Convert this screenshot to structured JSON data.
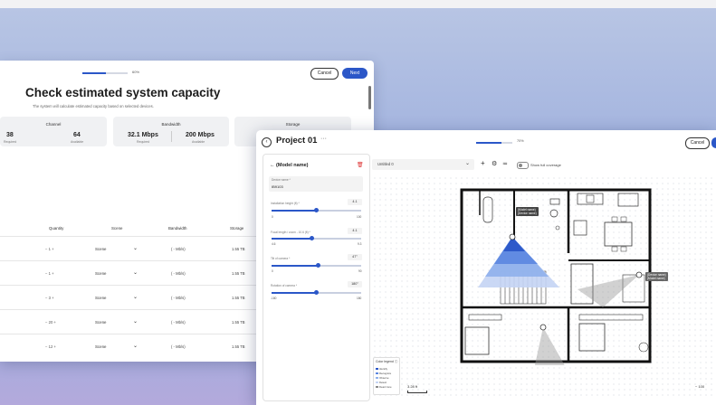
{
  "back_window": {
    "progress_pct": "60%",
    "progress_fraction": 0.52,
    "cancel_label": "Cancel",
    "next_label": "Next",
    "title": "Check estimated system capacity",
    "subtitle": "The system will calculate estimated capacity based on selected devices.",
    "cards": {
      "channel": {
        "title": "Channel",
        "required_value": "38",
        "required_label": "Required",
        "available_value": "64",
        "available_label": "Available"
      },
      "bandwidth": {
        "title": "Bandwidth",
        "required_value": "32.1 Mbps",
        "required_label": "Required",
        "available_value": "200 Mbps",
        "available_label": "Available"
      },
      "storage": {
        "title": "Storage"
      }
    },
    "table": {
      "headers": {
        "quantity": "Quantity",
        "scene": "Scene",
        "bandwidth": "Bandwidth",
        "storage": "Storage"
      },
      "rows": [
        {
          "qty": "− 1 +",
          "scene": "Scene",
          "bandwidth": "( - Mb/s)",
          "storage": "1.55 TB"
        },
        {
          "qty": "− 1 +",
          "scene": "Scene",
          "bandwidth": "( - Mb/s)",
          "storage": "1.55 TB"
        },
        {
          "qty": "− 3 +",
          "scene": "Scene",
          "bandwidth": "( - Mb/s)",
          "storage": "1.55 TB"
        },
        {
          "qty": "− 20 +",
          "scene": "Scene",
          "bandwidth": "( - Mb/s)",
          "storage": "1.55 TB"
        },
        {
          "qty": "− 12 +",
          "scene": "Scene",
          "bandwidth": "( - Mb/s)",
          "storage": "1.55 TB"
        }
      ]
    }
  },
  "front_window": {
    "title": "Project 01",
    "menu_glyph": "···",
    "progress_pct": "70%",
    "progress_fraction": 0.7,
    "cancel_label": "Cancel",
    "panel": {
      "title": "(Model name)",
      "device_name_label": "Device name *",
      "device_name_value": "IB9103",
      "sliders": [
        {
          "label": "Installation height (ft) *",
          "value": "4.1",
          "min": "0",
          "max": "100",
          "fraction": 0.5
        },
        {
          "label": "Focal length / zoom - 10.6 (ft) *",
          "value": "4.1",
          "min": "4.6",
          "max": "9.3",
          "fraction": 0.45
        },
        {
          "label": "Tilt of camera *",
          "value": "47°",
          "min": "0",
          "max": "90",
          "fraction": 0.52
        },
        {
          "label": "Rotation of camera *",
          "value": "180°",
          "min": "-180",
          "max": "180",
          "fraction": 0.5
        }
      ]
    },
    "toolbar": {
      "layout_select": "Untitled 0",
      "show_full_coverage": "Show full coverage",
      "toggle_on": false
    },
    "canvas": {
      "camera_tag_1": "(Model name)",
      "camera_tag_1b": "(Device name)",
      "camera_tag_2": "(Device name)",
      "camera_tag_2b": "(Model name)",
      "scale_label": "3.28 ft",
      "zoom_label": "− 100"
    },
    "legend": {
      "title": "Color legend",
      "items": [
        {
          "label": "Identify",
          "color": "#2b57c8"
        },
        {
          "label": "Recognize",
          "color": "#5b86e0"
        },
        {
          "label": "Observe",
          "color": "#8fb0ec"
        },
        {
          "label": "Detect",
          "color": "#c4d4f4"
        },
        {
          "label": "Dead zone",
          "color": "#888888"
        }
      ]
    }
  },
  "colors": {
    "accent": "#2b57c8",
    "background_top": "#b9c6e4",
    "background_bottom": "#b3a9dc"
  }
}
